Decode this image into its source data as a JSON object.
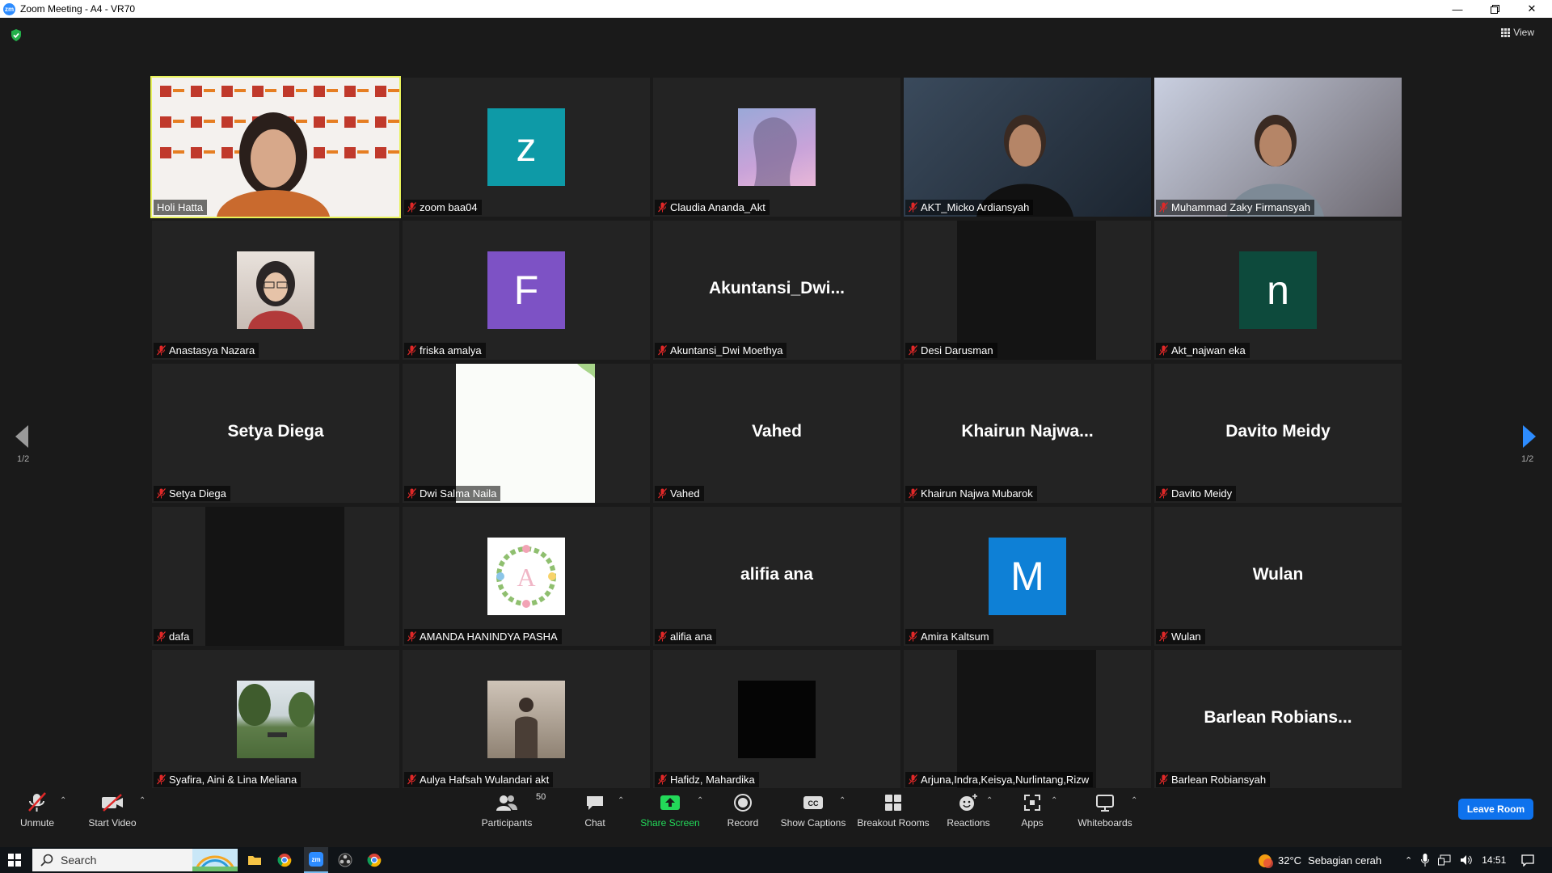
{
  "window": {
    "title": "Zoom Meeting - A4 - VR70",
    "logo": "zm"
  },
  "top": {
    "view_label": "View"
  },
  "pager": {
    "left_page": "1/2",
    "right_page": "1/2"
  },
  "tiles": [
    {
      "name": "Holi Hatta",
      "muted": false,
      "kind": "video",
      "active": true
    },
    {
      "name": "zoom baa04",
      "muted": true,
      "kind": "letter",
      "letter": "z",
      "color": "#0e9aa7"
    },
    {
      "name": "Claudia Ananda_Akt",
      "muted": true,
      "kind": "photo",
      "photo": "sky-tree"
    },
    {
      "name": "AKT_Micko Ardiansyah",
      "muted": true,
      "kind": "video"
    },
    {
      "name": "Muhammad Zaky Firmansyah",
      "muted": true,
      "kind": "video"
    },
    {
      "name": "Anastasya Nazara",
      "muted": true,
      "kind": "photo",
      "photo": "portrait"
    },
    {
      "name": "friska amalya",
      "muted": true,
      "kind": "letter",
      "letter": "F",
      "color": "#7d52c5"
    },
    {
      "name": "Akuntansi_Dwi Moethya",
      "muted": true,
      "kind": "text",
      "display": "Akuntansi_Dwi..."
    },
    {
      "name": "Desi Darusman",
      "muted": true,
      "kind": "dark"
    },
    {
      "name": "Akt_najwan eka",
      "muted": true,
      "kind": "letter",
      "letter": "n",
      "color": "#0d4a3c"
    },
    {
      "name": "Setya Diega",
      "muted": true,
      "kind": "text",
      "display": "Setya Diega"
    },
    {
      "name": "Dwi Salma Naila",
      "muted": true,
      "kind": "white"
    },
    {
      "name": "Vahed",
      "muted": true,
      "kind": "text",
      "display": "Vahed"
    },
    {
      "name": "Khairun Najwa Mubarok",
      "muted": true,
      "kind": "text",
      "display": "Khairun  Najwa..."
    },
    {
      "name": "Davito Meidy",
      "muted": true,
      "kind": "text",
      "display": "Davito Meidy"
    },
    {
      "name": "dafa",
      "muted": true,
      "kind": "dark"
    },
    {
      "name": "AMANDA HANINDYA PASHA",
      "muted": true,
      "kind": "photo",
      "photo": "wreath"
    },
    {
      "name": "alifia ana",
      "muted": true,
      "kind": "text",
      "display": "alifia ana"
    },
    {
      "name": "Amira Kaltsum",
      "muted": true,
      "kind": "letter",
      "letter": "M",
      "color": "#0e80d6"
    },
    {
      "name": "Wulan",
      "muted": true,
      "kind": "text",
      "display": "Wulan"
    },
    {
      "name": "Syafira, Aini & Lina Meliana",
      "muted": true,
      "kind": "photo",
      "photo": "landscape"
    },
    {
      "name": "Aulya Hafsah Wulandari akt",
      "muted": true,
      "kind": "photo",
      "photo": "person"
    },
    {
      "name": "Hafidz, Mahardika",
      "muted": true,
      "kind": "photo",
      "photo": "black"
    },
    {
      "name": "Arjuna,Indra,Keisya,Nurlintang,Rizw",
      "muted": true,
      "kind": "dark"
    },
    {
      "name": "Barlean Robiansyah",
      "muted": true,
      "kind": "text",
      "display": "Barlean  Robians..."
    }
  ],
  "toolbar": {
    "unmute": "Unmute",
    "start_video": "Start Video",
    "participants": "Participants",
    "participants_count": "50",
    "chat": "Chat",
    "share_screen": "Share Screen",
    "record": "Record",
    "show_captions": "Show Captions",
    "breakout_rooms": "Breakout Rooms",
    "reactions": "Reactions",
    "apps": "Apps",
    "whiteboards": "Whiteboards",
    "leave": "Leave Room"
  },
  "taskbar": {
    "search_label": "Search",
    "weather_temp": "32°C",
    "weather_desc": "Sebagian cerah",
    "time": "14:51"
  },
  "colors": {
    "share_green": "#23d959",
    "leave_blue": "#0e72ed",
    "active_border": "#e8f25a",
    "mute_red": "#e02828"
  }
}
